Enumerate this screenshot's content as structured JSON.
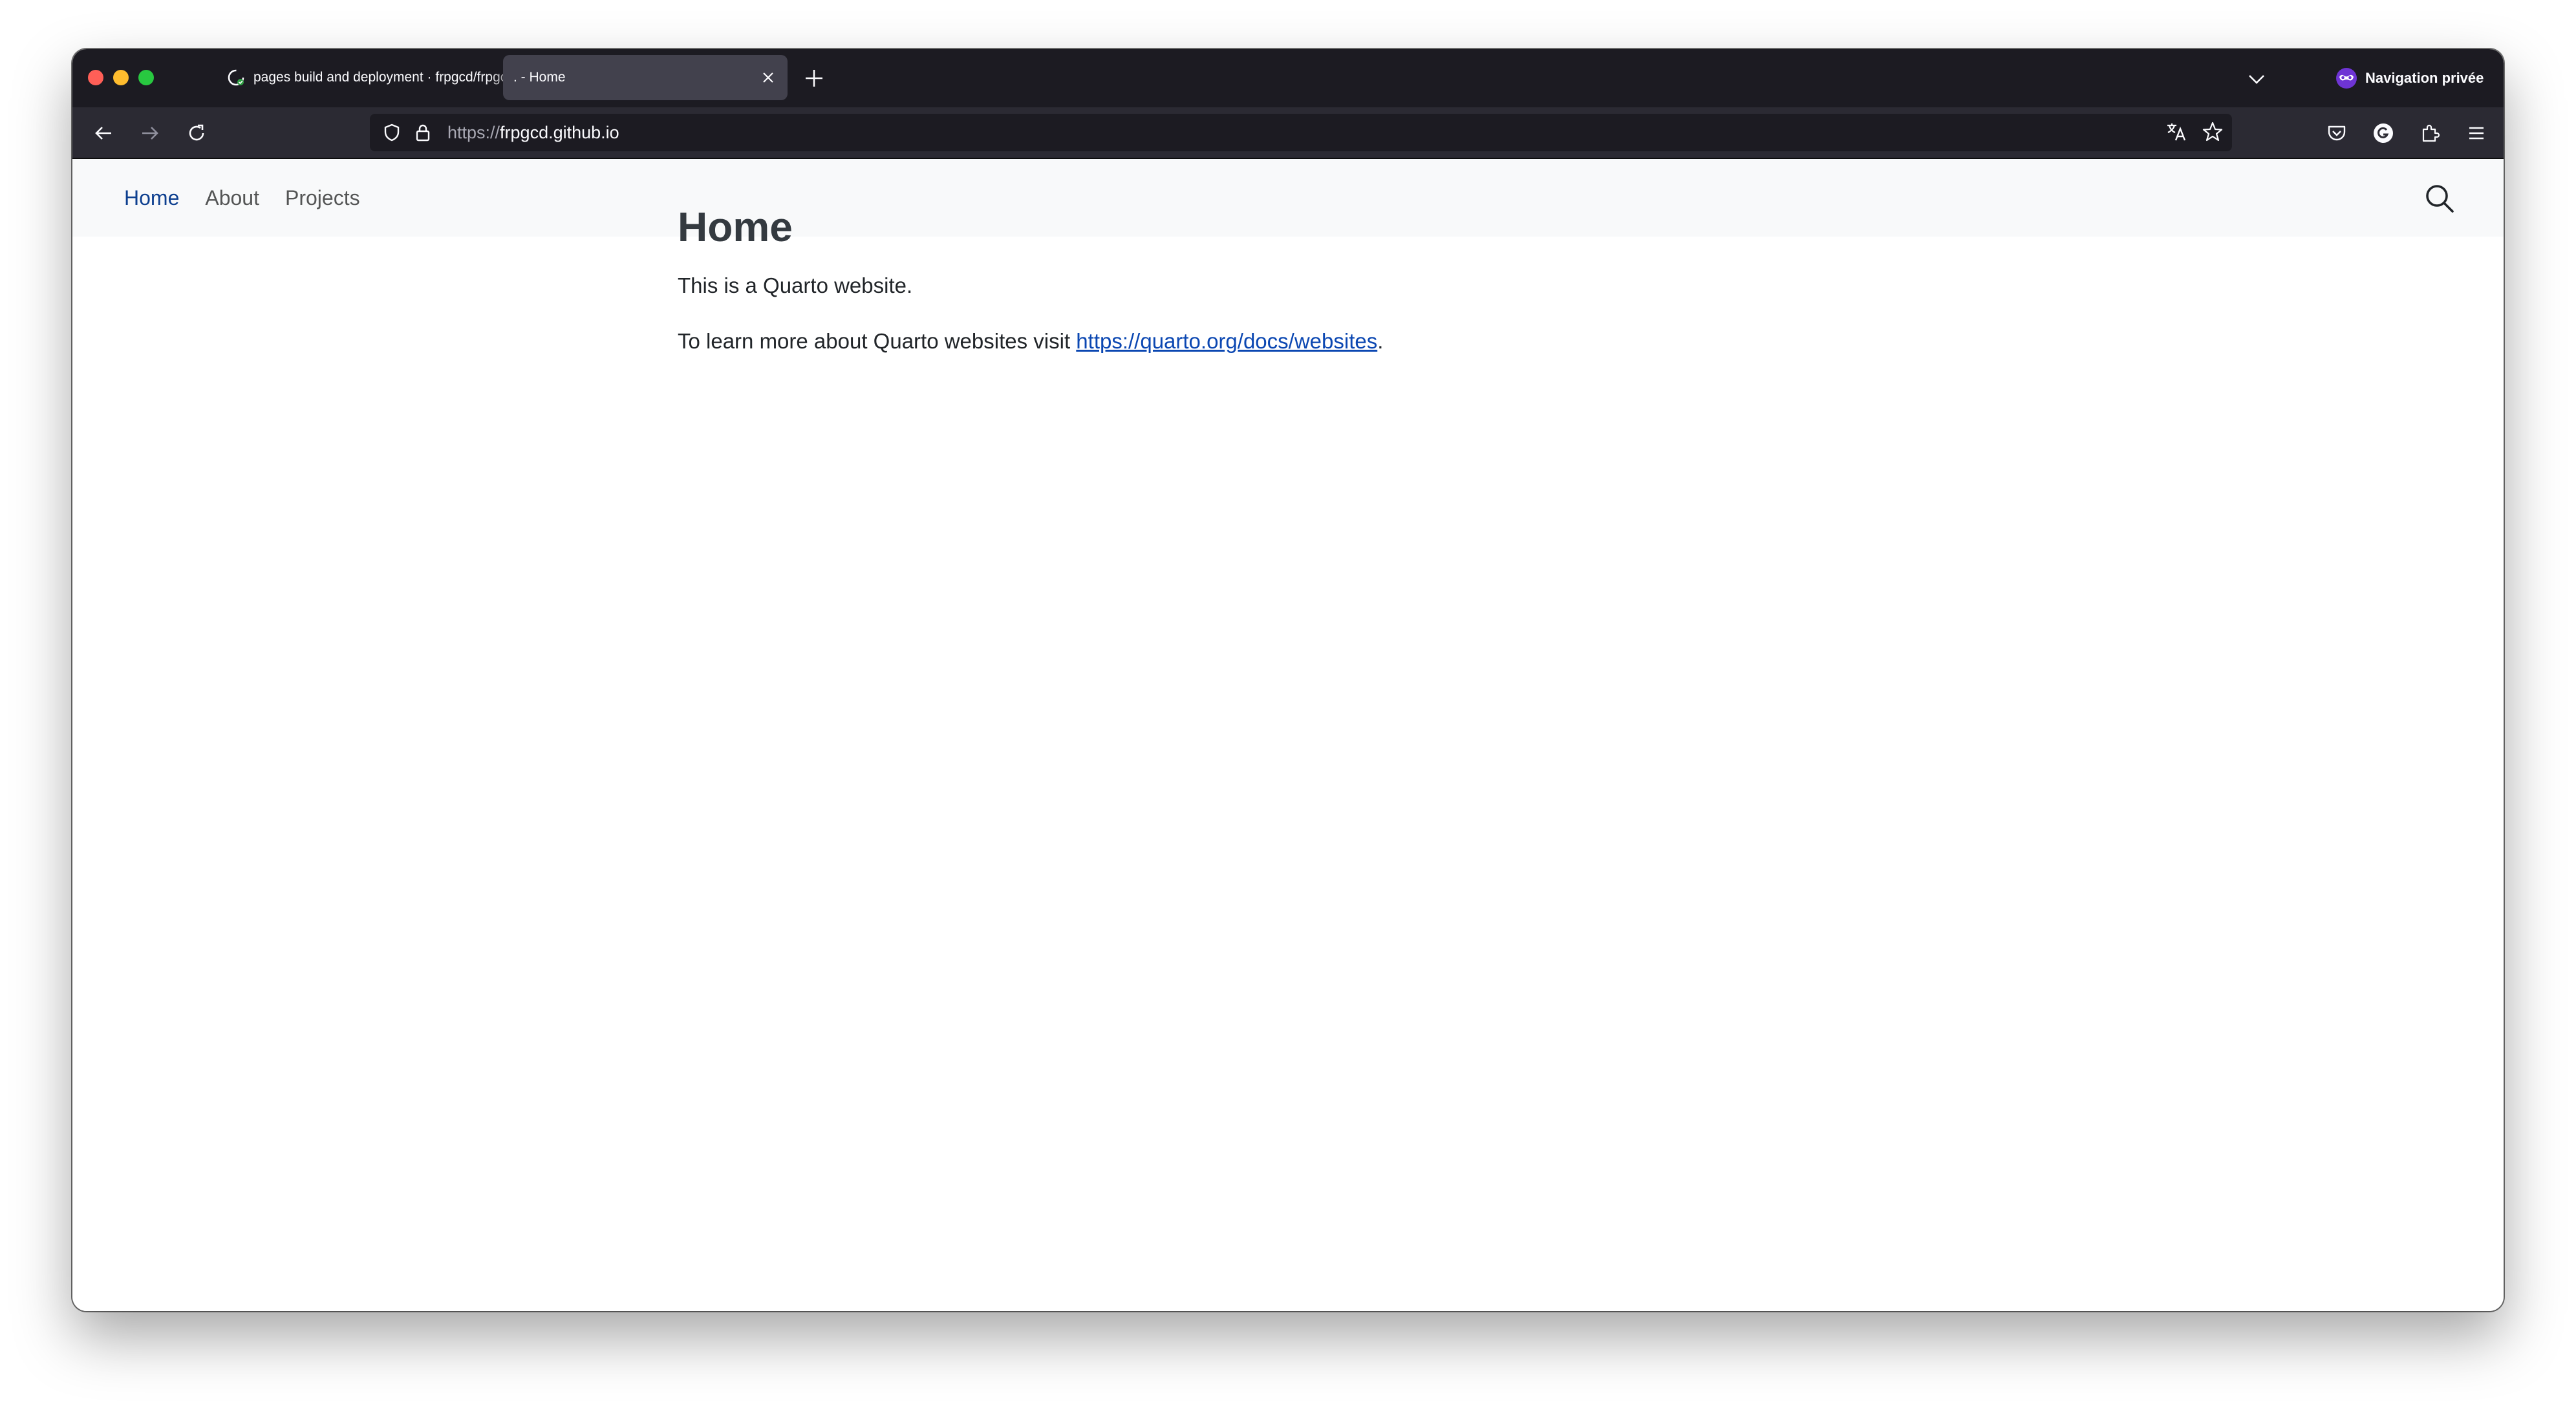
{
  "browser": {
    "tabs": [
      {
        "label": "pages build and deployment · frpgcd/frpgcd.github.io",
        "favicon": "github-icon",
        "active": false
      },
      {
        "label": ". - Home",
        "favicon": "",
        "active": true
      }
    ],
    "private_label": "Navigation privée",
    "url": {
      "scheme": "https://",
      "host": "frpgcd.github.io"
    }
  },
  "site": {
    "nav": [
      {
        "label": "Home",
        "active": true
      },
      {
        "label": "About",
        "active": false
      },
      {
        "label": "Projects",
        "active": false
      }
    ],
    "search_icon": "search-icon"
  },
  "content": {
    "title": "Home",
    "paragraph1": "This is a Quarto website.",
    "paragraph2_prefix": "To learn more about Quarto websites visit ",
    "link_text": "https://quarto.org/docs/websites",
    "paragraph2_suffix": "."
  },
  "colors": {
    "nav_active": "#0d3f8f",
    "link": "#0b47b2",
    "tabbar_bg": "#1c1b22",
    "toolbar_bg": "#2b2a33"
  }
}
